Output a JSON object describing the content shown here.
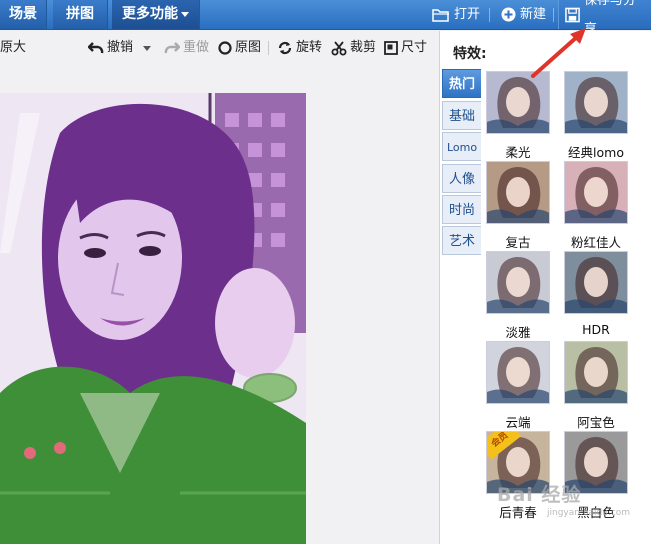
{
  "topbar": {
    "tabs": [
      {
        "label": "场景"
      },
      {
        "label": "拼图"
      },
      {
        "label": "更多功能"
      }
    ],
    "open_label": "打开",
    "new_label": "新建",
    "save_label": "保存与分享"
  },
  "toolbar": {
    "original_size_label": "原大",
    "undo_label": "撤销",
    "redo_label": "重做",
    "original_label": "原图",
    "rotate_label": "旋转",
    "crop_label": "裁剪",
    "size_label": "尺寸"
  },
  "panel": {
    "title": "特效:",
    "tabs": [
      {
        "label": "热门"
      },
      {
        "label": "基础"
      },
      {
        "label": "Lomo"
      },
      {
        "label": "人像"
      },
      {
        "label": "时尚"
      },
      {
        "label": "艺术"
      }
    ],
    "effects": [
      {
        "label": "柔光",
        "tone": "#b6b9cf"
      },
      {
        "label": "经典lomo",
        "tone": "#9fb2c8"
      },
      {
        "label": "复古",
        "tone": "#b59a86"
      },
      {
        "label": "粉红佳人",
        "tone": "#d7b0b8"
      },
      {
        "label": "淡雅",
        "tone": "#c9cbd4"
      },
      {
        "label": "HDR",
        "tone": "#7f8e9c"
      },
      {
        "label": "云端",
        "tone": "#d2d4dd"
      },
      {
        "label": "阿宝色",
        "tone": "#b9bfa4"
      },
      {
        "label": "后青春",
        "tone": "#c7b49c"
      },
      {
        "label": "黑白色",
        "tone": "#9a9a9a"
      }
    ],
    "vip_badge": "会员"
  },
  "watermark": {
    "text": "Bai 经验",
    "url": "jingyan.baidu.com"
  },
  "colors": {
    "topbar": "#2f73c4",
    "accent": "#3a7ccb",
    "arrow": "#e0342a"
  }
}
